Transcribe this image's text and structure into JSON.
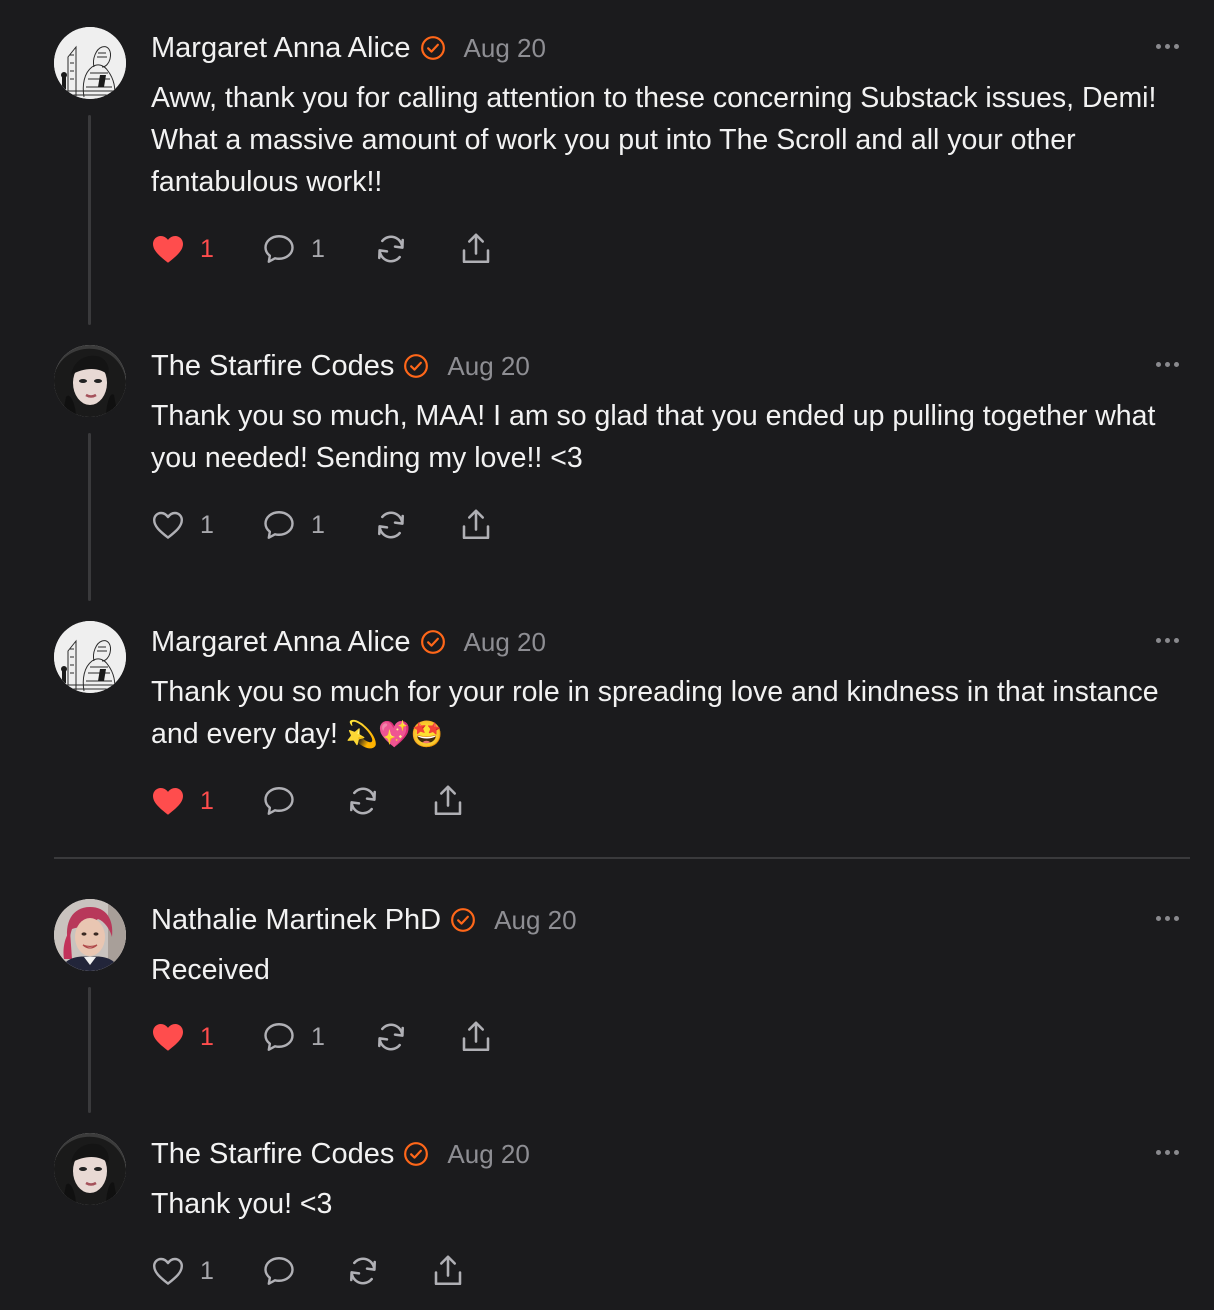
{
  "comments": [
    {
      "author": "Margaret Anna Alice",
      "date": "Aug 20",
      "text": "Aww, thank you for calling attention to these concerning Substack issues, Demi! What a massive amount of work you put into The Scroll and all your other fantabulous work!!",
      "likes": "1",
      "liked": true,
      "replies": "1",
      "avatar": "engraving-portrait"
    },
    {
      "author": "The Starfire Codes",
      "date": "Aug 20",
      "text": "Thank you so much, MAA! I am so glad that you ended up pulling together what you needed! Sending my love!! <3",
      "likes": "1",
      "liked": false,
      "replies": "1",
      "avatar": "woman-dark-hair-portrait"
    },
    {
      "author": "Margaret Anna Alice",
      "date": "Aug 20",
      "text": "Thank you so much for your role in spreading love and kindness in that instance and every day!",
      "emojis": "💫💖🤩",
      "likes": "1",
      "liked": true,
      "replies": "",
      "avatar": "engraving-portrait"
    },
    {
      "author": "Nathalie Martinek PhD",
      "date": "Aug 20",
      "text": "Received",
      "likes": "1",
      "liked": true,
      "replies": "1",
      "avatar": "woman-red-hair-portrait"
    },
    {
      "author": "The Starfire Codes",
      "date": "Aug 20",
      "text": "Thank you! <3",
      "likes": "1",
      "liked": false,
      "replies": "",
      "avatar": "woman-dark-hair-portrait"
    }
  ],
  "colors": {
    "background": "#1b1b1d",
    "accent": "#ff6719",
    "like": "#ff4d4d",
    "muted": "#8e8e93"
  },
  "icons": [
    "heart-icon",
    "comment-icon",
    "restack-icon",
    "share-icon",
    "verified-icon",
    "more-icon"
  ]
}
